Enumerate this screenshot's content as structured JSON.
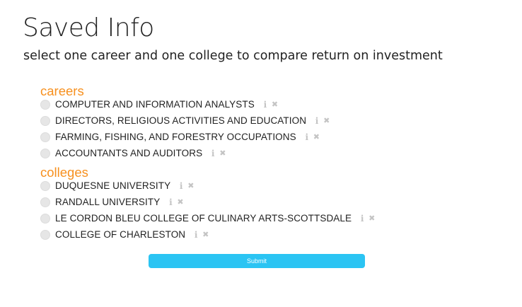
{
  "page": {
    "title": "Saved Info",
    "subtitle": "select one career and one college to compare return on investment"
  },
  "careers": {
    "heading": "careers",
    "items": [
      {
        "label": "COMPUTER AND INFORMATION ANALYSTS"
      },
      {
        "label": "DIRECTORS, RELIGIOUS ACTIVITIES AND EDUCATION"
      },
      {
        "label": "FARMING, FISHING, AND FORESTRY OCCUPATIONS"
      },
      {
        "label": "ACCOUNTANTS AND AUDITORS"
      }
    ]
  },
  "colleges": {
    "heading": "colleges",
    "items": [
      {
        "label": "DUQUESNE UNIVERSITY"
      },
      {
        "label": "RANDALL UNIVERSITY"
      },
      {
        "label": "LE CORDON BLEU COLLEGE OF CULINARY ARTS-SCOTTSDALE"
      },
      {
        "label": "COLLEGE OF CHARLESTON"
      }
    ]
  },
  "icons": {
    "info": "i",
    "remove": "✖",
    "info_name": "info-icon",
    "remove_name": "remove-icon"
  },
  "submit": {
    "label": "Submit"
  },
  "colors": {
    "accent_orange": "#f7901e",
    "button_blue": "#2bc4f3",
    "icon_gray": "#c4c4c4",
    "radio_gray": "#e6e6e6"
  }
}
